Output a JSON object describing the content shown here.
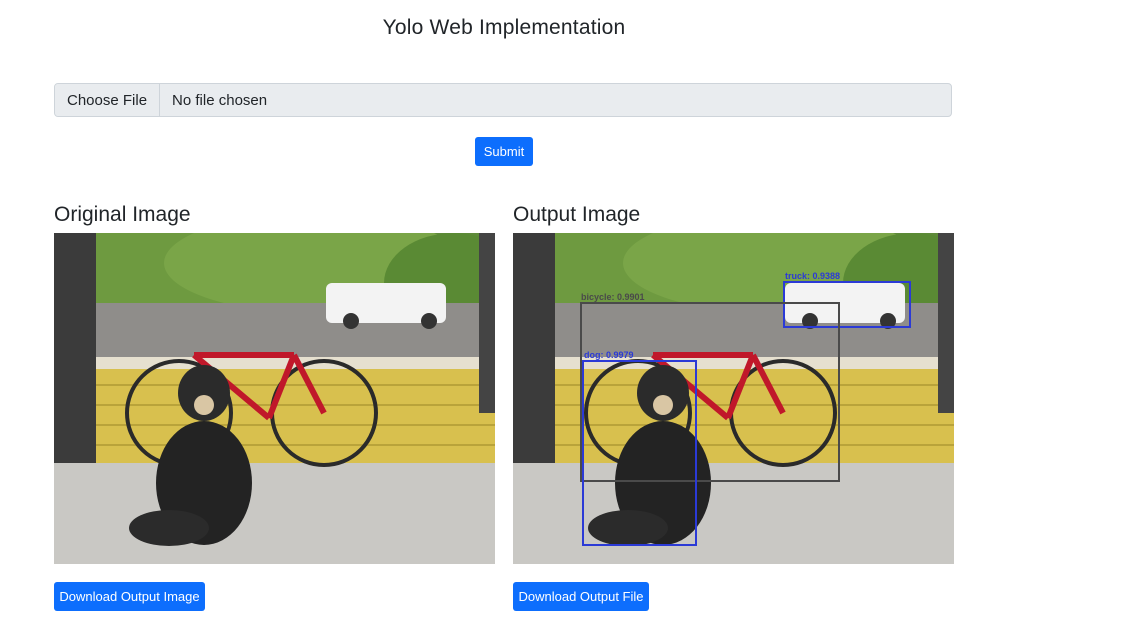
{
  "page": {
    "title": "Yolo Web Implementation"
  },
  "upload": {
    "choose_label": "Choose File",
    "status": "No file chosen",
    "submit_label": "Submit"
  },
  "original": {
    "heading": "Original Image"
  },
  "output": {
    "heading": "Output Image",
    "detections": [
      {
        "label": "truck: 0.9388"
      },
      {
        "label": "bicycle: 0.9901"
      },
      {
        "label": "dog: 0.9979"
      }
    ]
  },
  "downloads": {
    "image_label": "Download Output Image",
    "file_label": "Download Output File"
  },
  "colors": {
    "primary": "#0d6efd",
    "detection_blue": "#2b3ad6",
    "detection_gray": "#4a4a4a"
  }
}
